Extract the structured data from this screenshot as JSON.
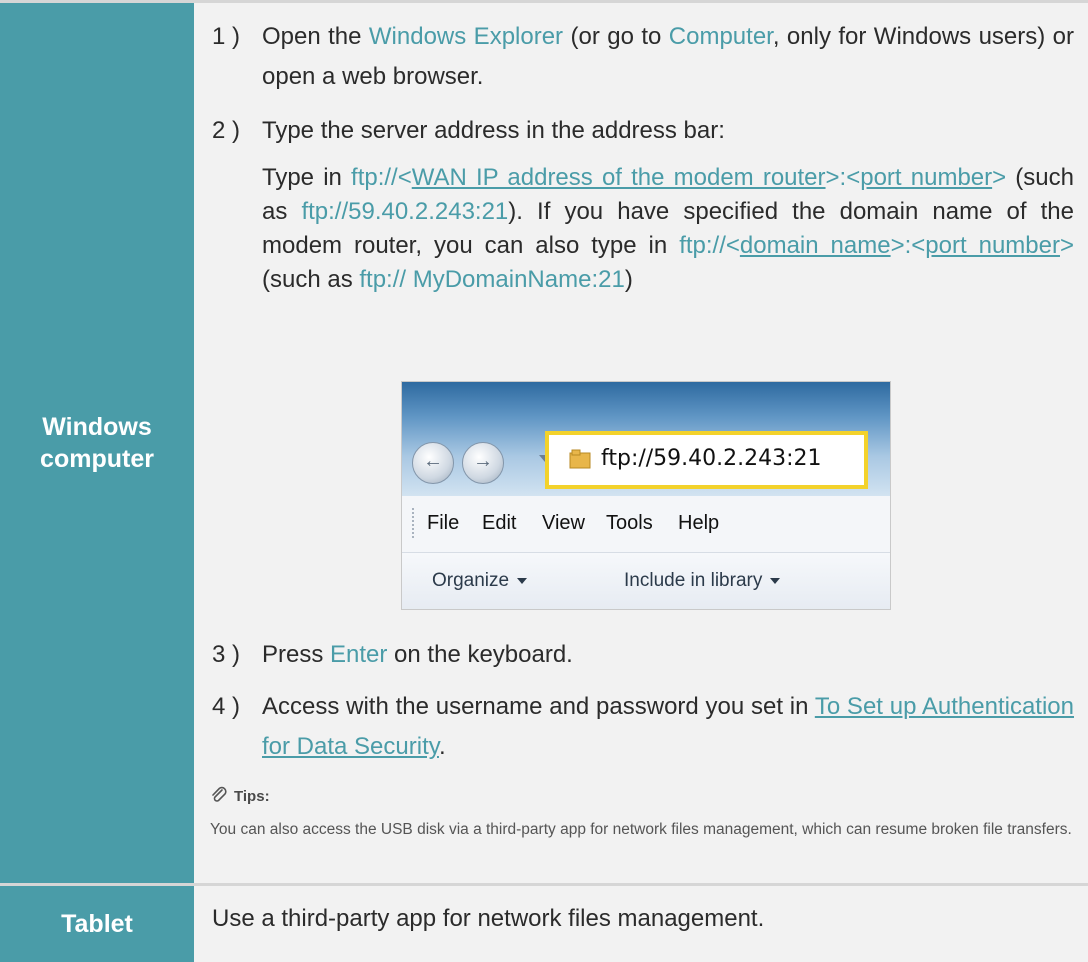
{
  "rows": [
    {
      "label": "Windows computer",
      "steps": [
        {
          "num": "1 )",
          "segments": [
            {
              "t": "Open the "
            },
            {
              "t": "Windows Explorer",
              "hl": true
            },
            {
              "t": " (or go to "
            },
            {
              "t": "Computer",
              "hl": true
            },
            {
              "t": ", only for Windows users) or open a web browser."
            }
          ]
        },
        {
          "num": "2 )",
          "text": "Type the server address in the address bar:"
        }
      ],
      "detail": [
        {
          "t": "Type in "
        },
        {
          "t": "ftp://<",
          "hl": true
        },
        {
          "t": "WAN IP address of the modem router",
          "ul": true
        },
        {
          "t": ">:<",
          "hl": true
        },
        {
          "t": "port number",
          "ul": true
        },
        {
          "t": ">",
          "hl": true
        },
        {
          "t": " (such as "
        },
        {
          "t": "ftp://59.40.2.243:21",
          "hl": true
        },
        {
          "t": "). If you have specified the domain name of the modem router, you can also type in "
        },
        {
          "t": "ftp://<",
          "hl": true
        },
        {
          "t": "domain name",
          "ul": true
        },
        {
          "t": ">:<",
          "hl": true
        },
        {
          "t": "port number",
          "ul": true
        },
        {
          "t": ">",
          "hl": true
        },
        {
          "t": " (such as "
        },
        {
          "t": "ftp:// MyDomainName:21",
          "hl": true
        },
        {
          "t": ")"
        }
      ],
      "screenshot": {
        "address": "ftp://59.40.2.243:21",
        "menus": [
          "File",
          "Edit",
          "View",
          "Tools",
          "Help"
        ],
        "toolbar": [
          "Organize",
          "Include in library"
        ]
      },
      "steps_after": [
        {
          "num": "3 )",
          "segments": [
            {
              "t": "Press "
            },
            {
              "t": "Enter",
              "hl": true
            },
            {
              "t": " on the keyboard."
            }
          ]
        },
        {
          "num": "4 )",
          "segments": [
            {
              "t": "Access with the username and password you set in "
            },
            {
              "t": "To Set up Authentication for Data Security",
              "ul": true
            },
            {
              "t": "."
            }
          ]
        }
      ],
      "tips": {
        "title": "Tips:",
        "body": "You can also access the USB disk via a third-party app for network files management, which can resume broken file transfers."
      }
    },
    {
      "label": "Tablet",
      "text": "Use a third-party app for network files management."
    }
  ],
  "colors": {
    "accent": "#4a9ca8",
    "cell_bg": "#f2f2f2",
    "highlight_border": "#f3d22b"
  },
  "icons": [
    "back-arrow-icon",
    "forward-arrow-icon",
    "folder-icon",
    "paperclip-icon"
  ]
}
